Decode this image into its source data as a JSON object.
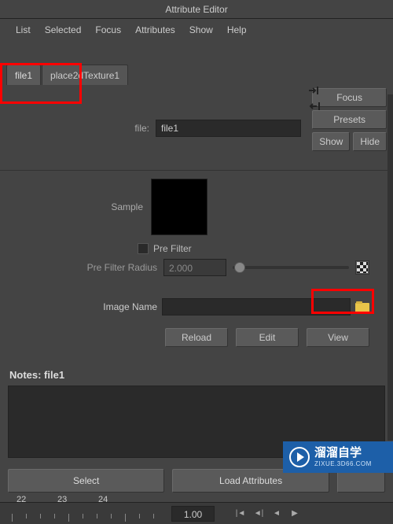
{
  "window": {
    "title": "Attribute Editor"
  },
  "menu": {
    "list": "List",
    "selected": "Selected",
    "focus": "Focus",
    "attributes": "Attributes",
    "show": "Show",
    "help": "Help"
  },
  "tabs": {
    "file1": "file1",
    "place2d": "place2dTexture1"
  },
  "side_buttons": {
    "focus": "Focus",
    "presets": "Presets",
    "show": "Show",
    "hide": "Hide"
  },
  "file_row": {
    "label": "file:",
    "value": "file1"
  },
  "sample": {
    "label": "Sample"
  },
  "prefilter": {
    "label": "Pre Filter",
    "radius_label": "Pre Filter Radius",
    "value": "2.000"
  },
  "image_name": {
    "label": "Image Name",
    "value": ""
  },
  "actions": {
    "reload": "Reload",
    "edit": "Edit",
    "view": "View"
  },
  "notes": {
    "header": "Notes: file1"
  },
  "bottom": {
    "select": "Select",
    "load": "Load Attributes"
  },
  "timeline": {
    "t1": "22",
    "t2": "23",
    "t3": "24",
    "frame": "1.00"
  },
  "watermark": {
    "brand": "溜溜自学",
    "sub": "ZIXUE.3D66.COM"
  }
}
